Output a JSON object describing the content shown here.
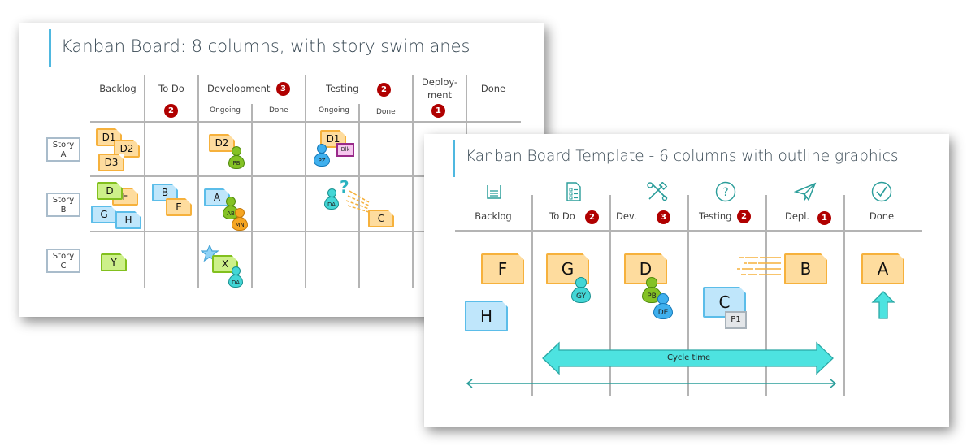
{
  "slide1": {
    "title": "Kanban Board: 8 columns, with story swimlanes",
    "columns": [
      {
        "label": "Backlog"
      },
      {
        "label": "To Do",
        "wip": "2"
      },
      {
        "label": "Development",
        "wip": "3",
        "sub": [
          "Ongoing",
          "Done"
        ]
      },
      {
        "label": "Testing",
        "wip": "2",
        "sub": [
          "Ongoing",
          "Done"
        ]
      },
      {
        "label_line1": "Deploy-",
        "label_line2": "ment",
        "wip": "1"
      },
      {
        "label": "Done"
      }
    ],
    "stories": [
      {
        "line1": "Story",
        "line2": "A"
      },
      {
        "line1": "Story",
        "line2": "B"
      },
      {
        "line1": "Story",
        "line2": "C"
      }
    ],
    "cards": {
      "a_backlog": [
        "D1",
        "D2",
        "D3"
      ],
      "a_dev": "D2",
      "a_dev_owner": "PB",
      "a_test": "D1",
      "a_test_owner": "PZ",
      "a_test_blocker": "Blk",
      "b_backlog": [
        "D",
        "F",
        "G",
        "H"
      ],
      "b_todo": [
        "B",
        "E"
      ],
      "b_dev": "A",
      "b_dev_owners": [
        "AB",
        "MN"
      ],
      "b_test_owner": "DA",
      "b_test_question": "?",
      "b_test_card": "C",
      "c_backlog": "Y",
      "c_dev": "X",
      "c_dev_owner": "DA"
    }
  },
  "slide2": {
    "title": "Kanban Board Template - 6 columns with outline graphics",
    "columns": [
      {
        "label": "Backlog",
        "icon": "basket-icon"
      },
      {
        "label": "To Do",
        "wip": "2",
        "icon": "checklist-icon"
      },
      {
        "label": "Dev.",
        "wip": "3",
        "icon": "tools-icon"
      },
      {
        "label": "Testing",
        "wip": "2",
        "icon": "question-icon"
      },
      {
        "label": "Depl.",
        "wip": "1",
        "icon": "paper-plane-icon"
      },
      {
        "label": "Done",
        "icon": "checkmark-circle-icon"
      }
    ],
    "cards": {
      "backlog": [
        "F",
        "H"
      ],
      "todo": "G",
      "todo_owner": "GY",
      "dev": "D",
      "dev_owners": [
        "PB",
        "DE"
      ],
      "testing": "C",
      "testing_priority": "P1",
      "depl": "B",
      "done": "A"
    },
    "cycle_time_label": "Cycle time"
  },
  "colors": {
    "accent_bar": "#4fb8e0",
    "wip_badge": "#b00000",
    "card_orange": "#fedc9e",
    "card_blue": "#bfe6fb",
    "card_green": "#cdf08a",
    "cycle_arrow": "#4de3e0",
    "outline_icon": "#2a9d9a"
  }
}
